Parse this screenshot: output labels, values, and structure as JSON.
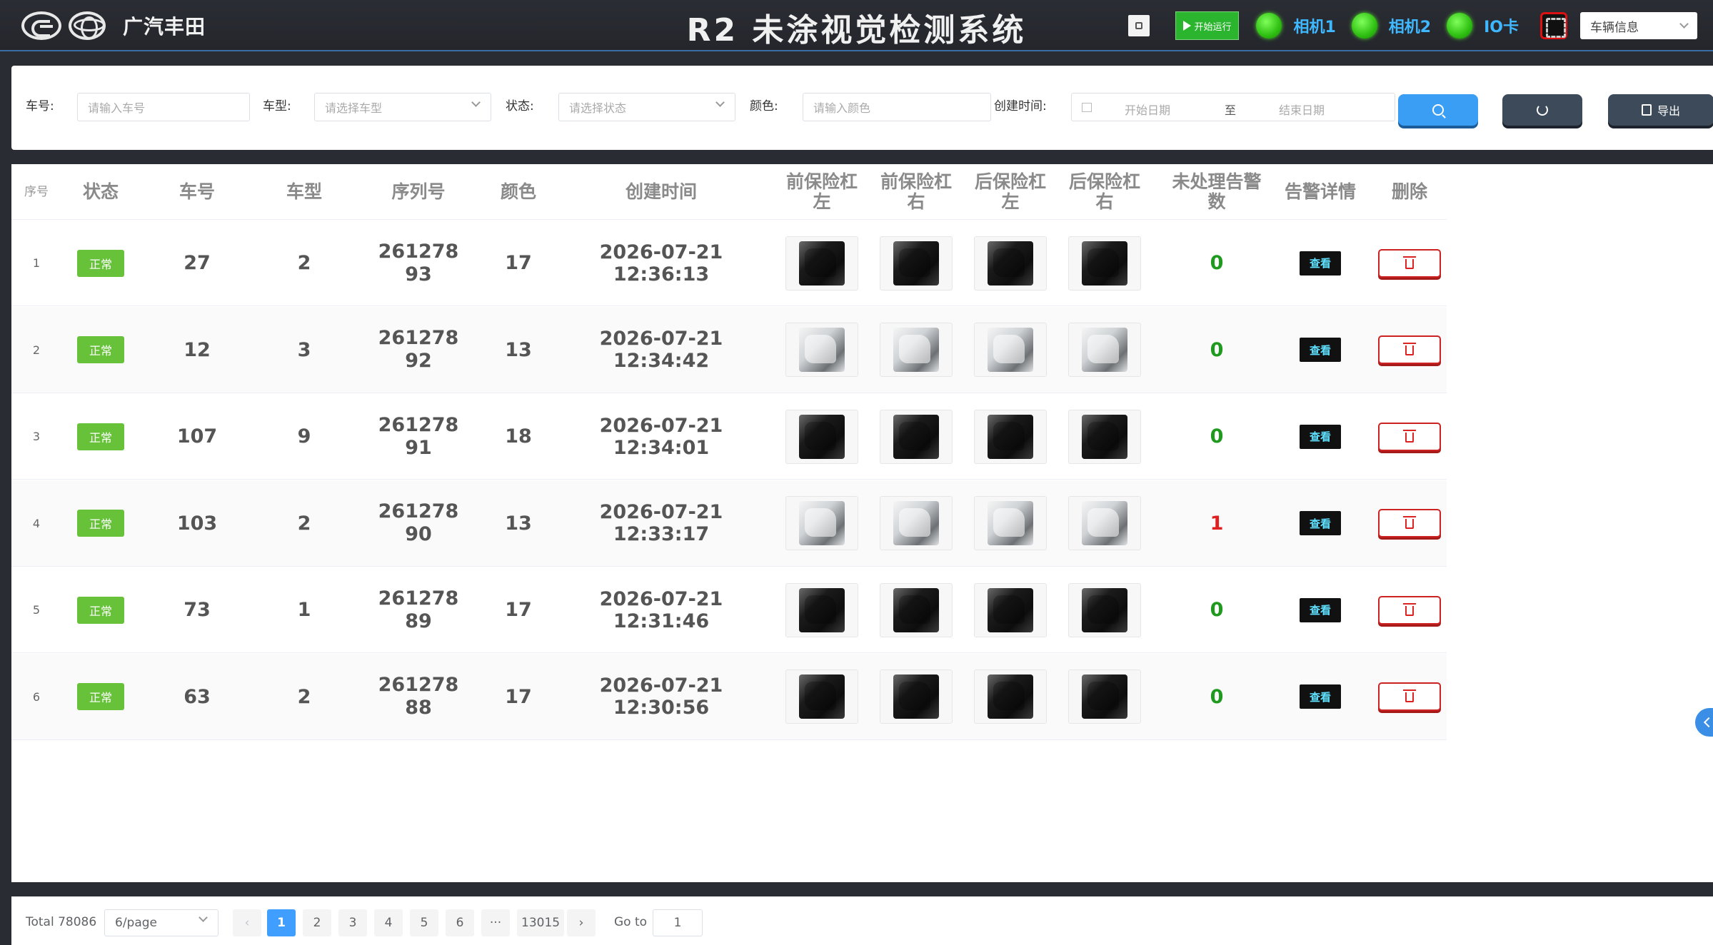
{
  "header": {
    "brand": "广汽丰田",
    "title": "R2 未涂视觉检测系统",
    "start_button": "开始运行",
    "devices": [
      {
        "label": "相机1",
        "status_color": "#2fbf12"
      },
      {
        "label": "相机2",
        "status_color": "#2fbf12"
      },
      {
        "label": "IO卡",
        "status_color": "#2fbf12"
      }
    ],
    "vehicle_select": "车辆信息"
  },
  "filters": {
    "car_no_label": "车号:",
    "car_no_placeholder": "请输入车号",
    "model_label": "车型:",
    "model_placeholder": "请选择车型",
    "status_label": "状态:",
    "status_placeholder": "请选择状态",
    "color_label": "颜色:",
    "color_placeholder": "请输入颜色",
    "created_label": "创建时间:",
    "start_date_placeholder": "开始日期",
    "range_separator": "至",
    "end_date_placeholder": "结束日期",
    "export_label": "导出"
  },
  "table": {
    "headers": {
      "index": "序号",
      "status": "状态",
      "car_no": "车号",
      "model": "车型",
      "serial": "序列号",
      "color": "颜色",
      "created": "创建时间",
      "front_left": "前保险杠左",
      "front_right": "前保险杠右",
      "rear_left": "后保险杠左",
      "rear_right": "后保险杠右",
      "unhandled": "未处理告警数",
      "alarm_detail": "告警详情",
      "delete": "删除"
    },
    "view_label": "查看",
    "rows": [
      {
        "index": "1",
        "status": "正常",
        "car_no": "27",
        "model": "2",
        "serial": "26127893",
        "color": "17",
        "created": "2026-07-21 12:36:13",
        "unhandled": "0",
        "thumb_tone": "dark"
      },
      {
        "index": "2",
        "status": "正常",
        "car_no": "12",
        "model": "3",
        "serial": "26127892",
        "color": "13",
        "created": "2026-07-21 12:34:42",
        "unhandled": "0",
        "thumb_tone": "light"
      },
      {
        "index": "3",
        "status": "正常",
        "car_no": "107",
        "model": "9",
        "serial": "26127891",
        "color": "18",
        "created": "2026-07-21 12:34:01",
        "unhandled": "0",
        "thumb_tone": "dark"
      },
      {
        "index": "4",
        "status": "正常",
        "car_no": "103",
        "model": "2",
        "serial": "26127890",
        "color": "13",
        "created": "2026-07-21 12:33:17",
        "unhandled": "1",
        "thumb_tone": "light"
      },
      {
        "index": "5",
        "status": "正常",
        "car_no": "73",
        "model": "1",
        "serial": "26127889",
        "color": "17",
        "created": "2026-07-21 12:31:46",
        "unhandled": "0",
        "thumb_tone": "dark"
      },
      {
        "index": "6",
        "status": "正常",
        "car_no": "63",
        "model": "2",
        "serial": "26127888",
        "color": "17",
        "created": "2026-07-21 12:30:56",
        "unhandled": "0",
        "thumb_tone": "dark"
      }
    ],
    "colors": {
      "ok": "#67c23a",
      "warn_zero": "#1f9a1f",
      "warn_nonzero": "#e02020"
    }
  },
  "pagination": {
    "total": "Total 78086",
    "page_size": "6/page",
    "pages": [
      "1",
      "2",
      "3",
      "4",
      "5",
      "6"
    ],
    "ellipsis": "···",
    "last_page": "13015",
    "current": "1",
    "goto_label": "Go to",
    "goto_value": "1"
  }
}
